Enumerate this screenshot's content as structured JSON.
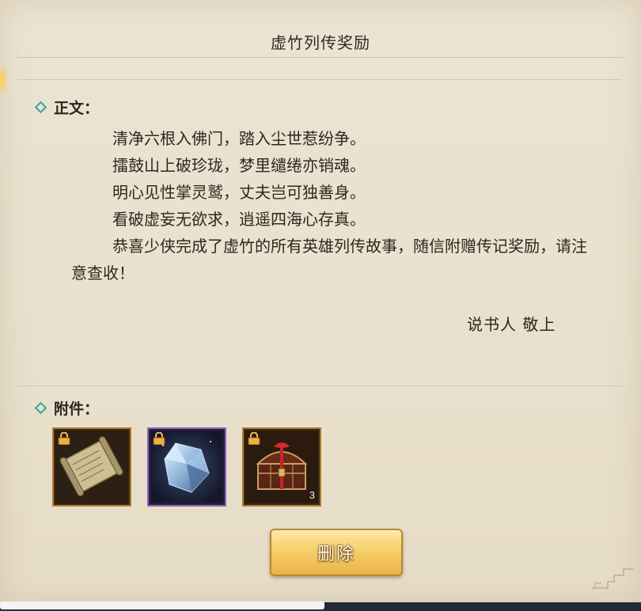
{
  "mail": {
    "title": "虚竹列传奖励",
    "body_section_label": "正文：",
    "body_lines": [
      "清净六根入佛门，踏入尘世惹纷争。",
      "擂鼓山上破珍珑，梦里缱绻亦销魂。",
      "明心见性掌灵鹫，丈夫岂可独善身。",
      "看破虚妄无欲求，逍遥四海心存真。",
      "恭喜少侠完成了虚竹的所有英雄列传故事，随信附赠传记奖励，请注意查收！"
    ],
    "signature": "说书人  敬上",
    "attachments_label": "附件：",
    "attachments": [
      {
        "icon": "scroll-icon",
        "rarity": "gold",
        "locked": true,
        "count": ""
      },
      {
        "icon": "crystal-icon",
        "rarity": "purple",
        "locked": true,
        "count": ""
      },
      {
        "icon": "treasure-chest-icon",
        "rarity": "gold",
        "locked": true,
        "count": "3"
      }
    ],
    "delete_label": "删除"
  },
  "colors": {
    "panel_bg": "#ece4d2",
    "accent_teal": "#3aa39a",
    "button_gold": "#f6cf68",
    "frame_gold": "#b07a2c",
    "frame_purple": "#8b63b8"
  }
}
